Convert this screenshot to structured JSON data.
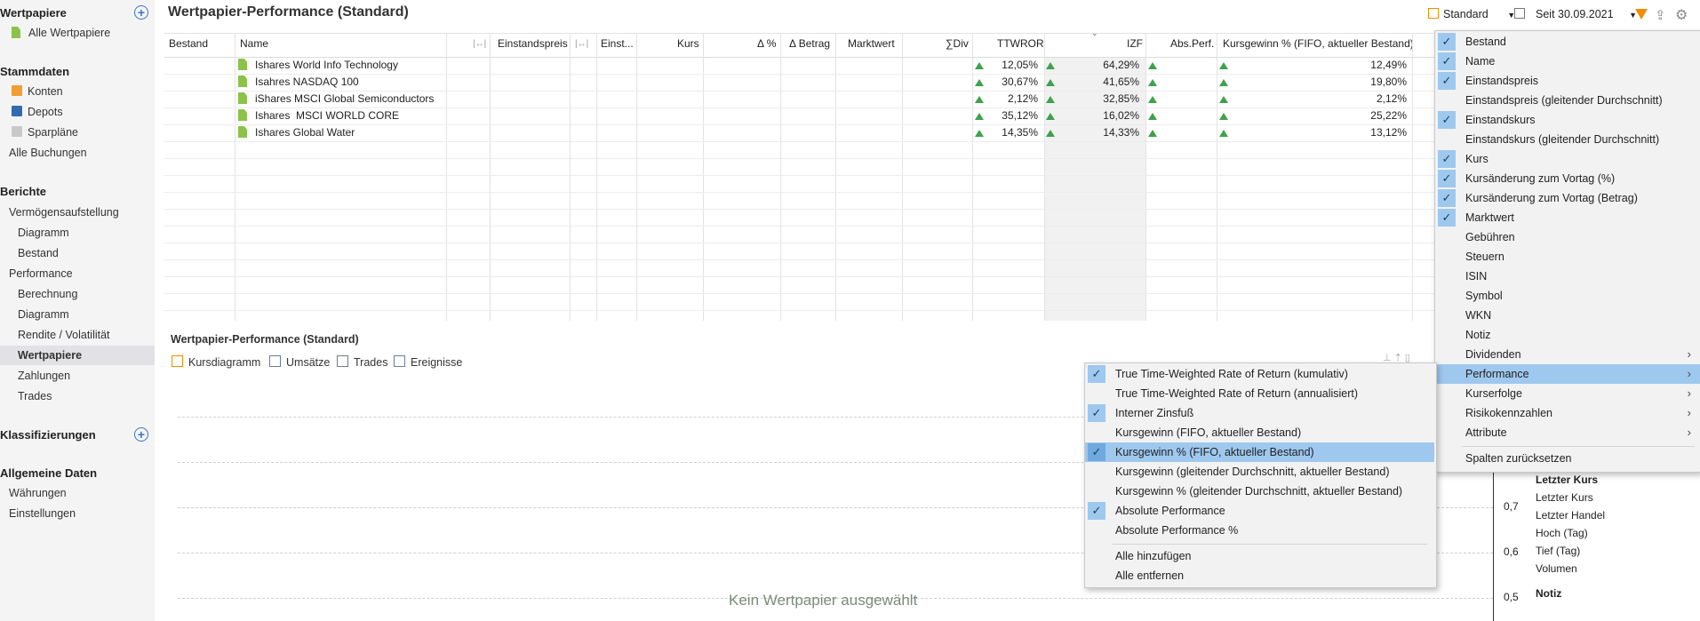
{
  "sidebar": {
    "wertpapiere_header": "Wertpapiere",
    "alle_wertpapiere": "Alle Wertpapiere",
    "stammdaten_header": "Stammdaten",
    "konten": "Konten",
    "depots": "Depots",
    "sparplaene": "Sparpläne",
    "alle_buchungen": "Alle Buchungen",
    "berichte_header": "Berichte",
    "vermoegensaufstellung": "Vermögensaufstellung",
    "diagramm1": "Diagramm",
    "bestand": "Bestand",
    "performance": "Performance",
    "berechnung": "Berechnung",
    "diagramm2": "Diagramm",
    "rendite": "Rendite / Volatilität",
    "wertpapiere": "Wertpapiere",
    "zahlungen": "Zahlungen",
    "trades": "Trades",
    "klassifizierungen_header": "Klassifizierungen",
    "allgemeine_header": "Allgemeine Daten",
    "waehrungen": "Währungen",
    "einstellungen": "Einstellungen"
  },
  "main": {
    "title": "Wertpapier-Performance (Standard)",
    "toolbar": {
      "view_label": "Standard",
      "date_label": "Seit 30.09.2021"
    },
    "columns": {
      "bestand": "Bestand",
      "name": "Name",
      "move1": "|↔|",
      "einstandspreis": "Einstandspreis",
      "move2": "|↔|",
      "einst": "Einst...",
      "kurs": "Kurs",
      "delta_pct": "Δ %",
      "delta_betrag": "Δ Betrag",
      "marktwert": "Marktwert",
      "sum_div": "∑Div",
      "ttwror": "TTWROR",
      "izf": "IZF",
      "abs_perf": "Abs.Perf.",
      "kursgewinn": "Kursgewinn % (FIFO, aktueller Bestand)"
    },
    "rows": [
      {
        "name": "Ishares World Info Technology",
        "ttwror": "12,05%",
        "izf": "64,29%",
        "kursgewinn": "12,49%"
      },
      {
        "name": "Isahres NASDAQ 100",
        "ttwror": "30,67%",
        "izf": "41,65%",
        "kursgewinn": "19,80%"
      },
      {
        "name": "iShares MSCI Global Semiconductors",
        "ttwror": "2,12%",
        "izf": "32,85%",
        "kursgewinn": "2,12%"
      },
      {
        "name": "Ishares  MSCI WORLD CORE",
        "ttwror": "35,12%",
        "izf": "16,02%",
        "kursgewinn": "25,22%"
      },
      {
        "name": "Ishares Global Water",
        "ttwror": "14,35%",
        "izf": "14,33%",
        "kursgewinn": "13,12%"
      }
    ]
  },
  "bottom": {
    "title": "Wertpapier-Performance (Standard)",
    "tabs": [
      "Kursdiagramm",
      "Umsätze",
      "Trades",
      "Ereignisse"
    ],
    "empty_message": "Kein Wertpapier ausgewählt",
    "axis_ticks": [
      "0,7",
      "0,6",
      "0,5"
    ],
    "info_labels": [
      "Letzter Kurs",
      "Letzter Kurs",
      "Letzter Handel",
      "Hoch (Tag)",
      "Tief (Tag)",
      "Volumen",
      "Notiz"
    ]
  },
  "column_menu": {
    "items": [
      {
        "label": "Bestand",
        "checked": true
      },
      {
        "label": "Name",
        "checked": true
      },
      {
        "label": "Einstandspreis",
        "checked": true
      },
      {
        "label": "Einstandspreis (gleitender Durchschnitt)",
        "checked": false
      },
      {
        "label": "Einstandskurs",
        "checked": true
      },
      {
        "label": "Einstandskurs (gleitender Durchschnitt)",
        "checked": false
      },
      {
        "label": "Kurs",
        "checked": true
      },
      {
        "label": "Kursänderung zum Vortag (%)",
        "checked": true
      },
      {
        "label": "Kursänderung zum Vortag (Betrag)",
        "checked": true
      },
      {
        "label": "Marktwert",
        "checked": true
      },
      {
        "label": "Gebühren",
        "checked": false
      },
      {
        "label": "Steuern",
        "checked": false
      },
      {
        "label": "ISIN",
        "checked": false
      },
      {
        "label": "Symbol",
        "checked": false
      },
      {
        "label": "WKN",
        "checked": false
      },
      {
        "label": "Notiz",
        "checked": false
      },
      {
        "label": "Dividenden",
        "checked": false,
        "submenu": true
      },
      {
        "label": "Performance",
        "checked": false,
        "submenu": true,
        "highlight": true
      },
      {
        "label": "Kurserfolge",
        "checked": false,
        "submenu": true
      },
      {
        "label": "Risikokennzahlen",
        "checked": false,
        "submenu": true
      },
      {
        "label": "Attribute",
        "checked": false,
        "submenu": true
      }
    ],
    "reset_label": "Spalten zurücksetzen"
  },
  "performance_menu": {
    "items": [
      {
        "label": "True Time-Weighted Rate of Return (kumulativ)",
        "checked": true
      },
      {
        "label": "True Time-Weighted Rate of Return (annualisiert)",
        "checked": false
      },
      {
        "label": "Interner Zinsfuß",
        "checked": true
      },
      {
        "label": "Kursgewinn (FIFO, aktueller Bestand)",
        "checked": false
      },
      {
        "label": "Kursgewinn % (FIFO, aktueller Bestand)",
        "checked": true,
        "highlight": true
      },
      {
        "label": "Kursgewinn (gleitender Durchschnitt, aktueller Bestand)",
        "checked": false
      },
      {
        "label": "Kursgewinn % (gleitender Durchschnitt, aktueller Bestand)",
        "checked": false
      },
      {
        "label": "Absolute Performance",
        "checked": true
      },
      {
        "label": "Absolute Performance %",
        "checked": false
      }
    ],
    "add_all": "Alle hinzufügen",
    "remove_all": "Alle entfernen"
  },
  "colors": {
    "accent": "#3a76c4",
    "menu_highlight": "#9fc8ee",
    "positive": "#3da24a",
    "filter_icon": "#f28c00"
  }
}
